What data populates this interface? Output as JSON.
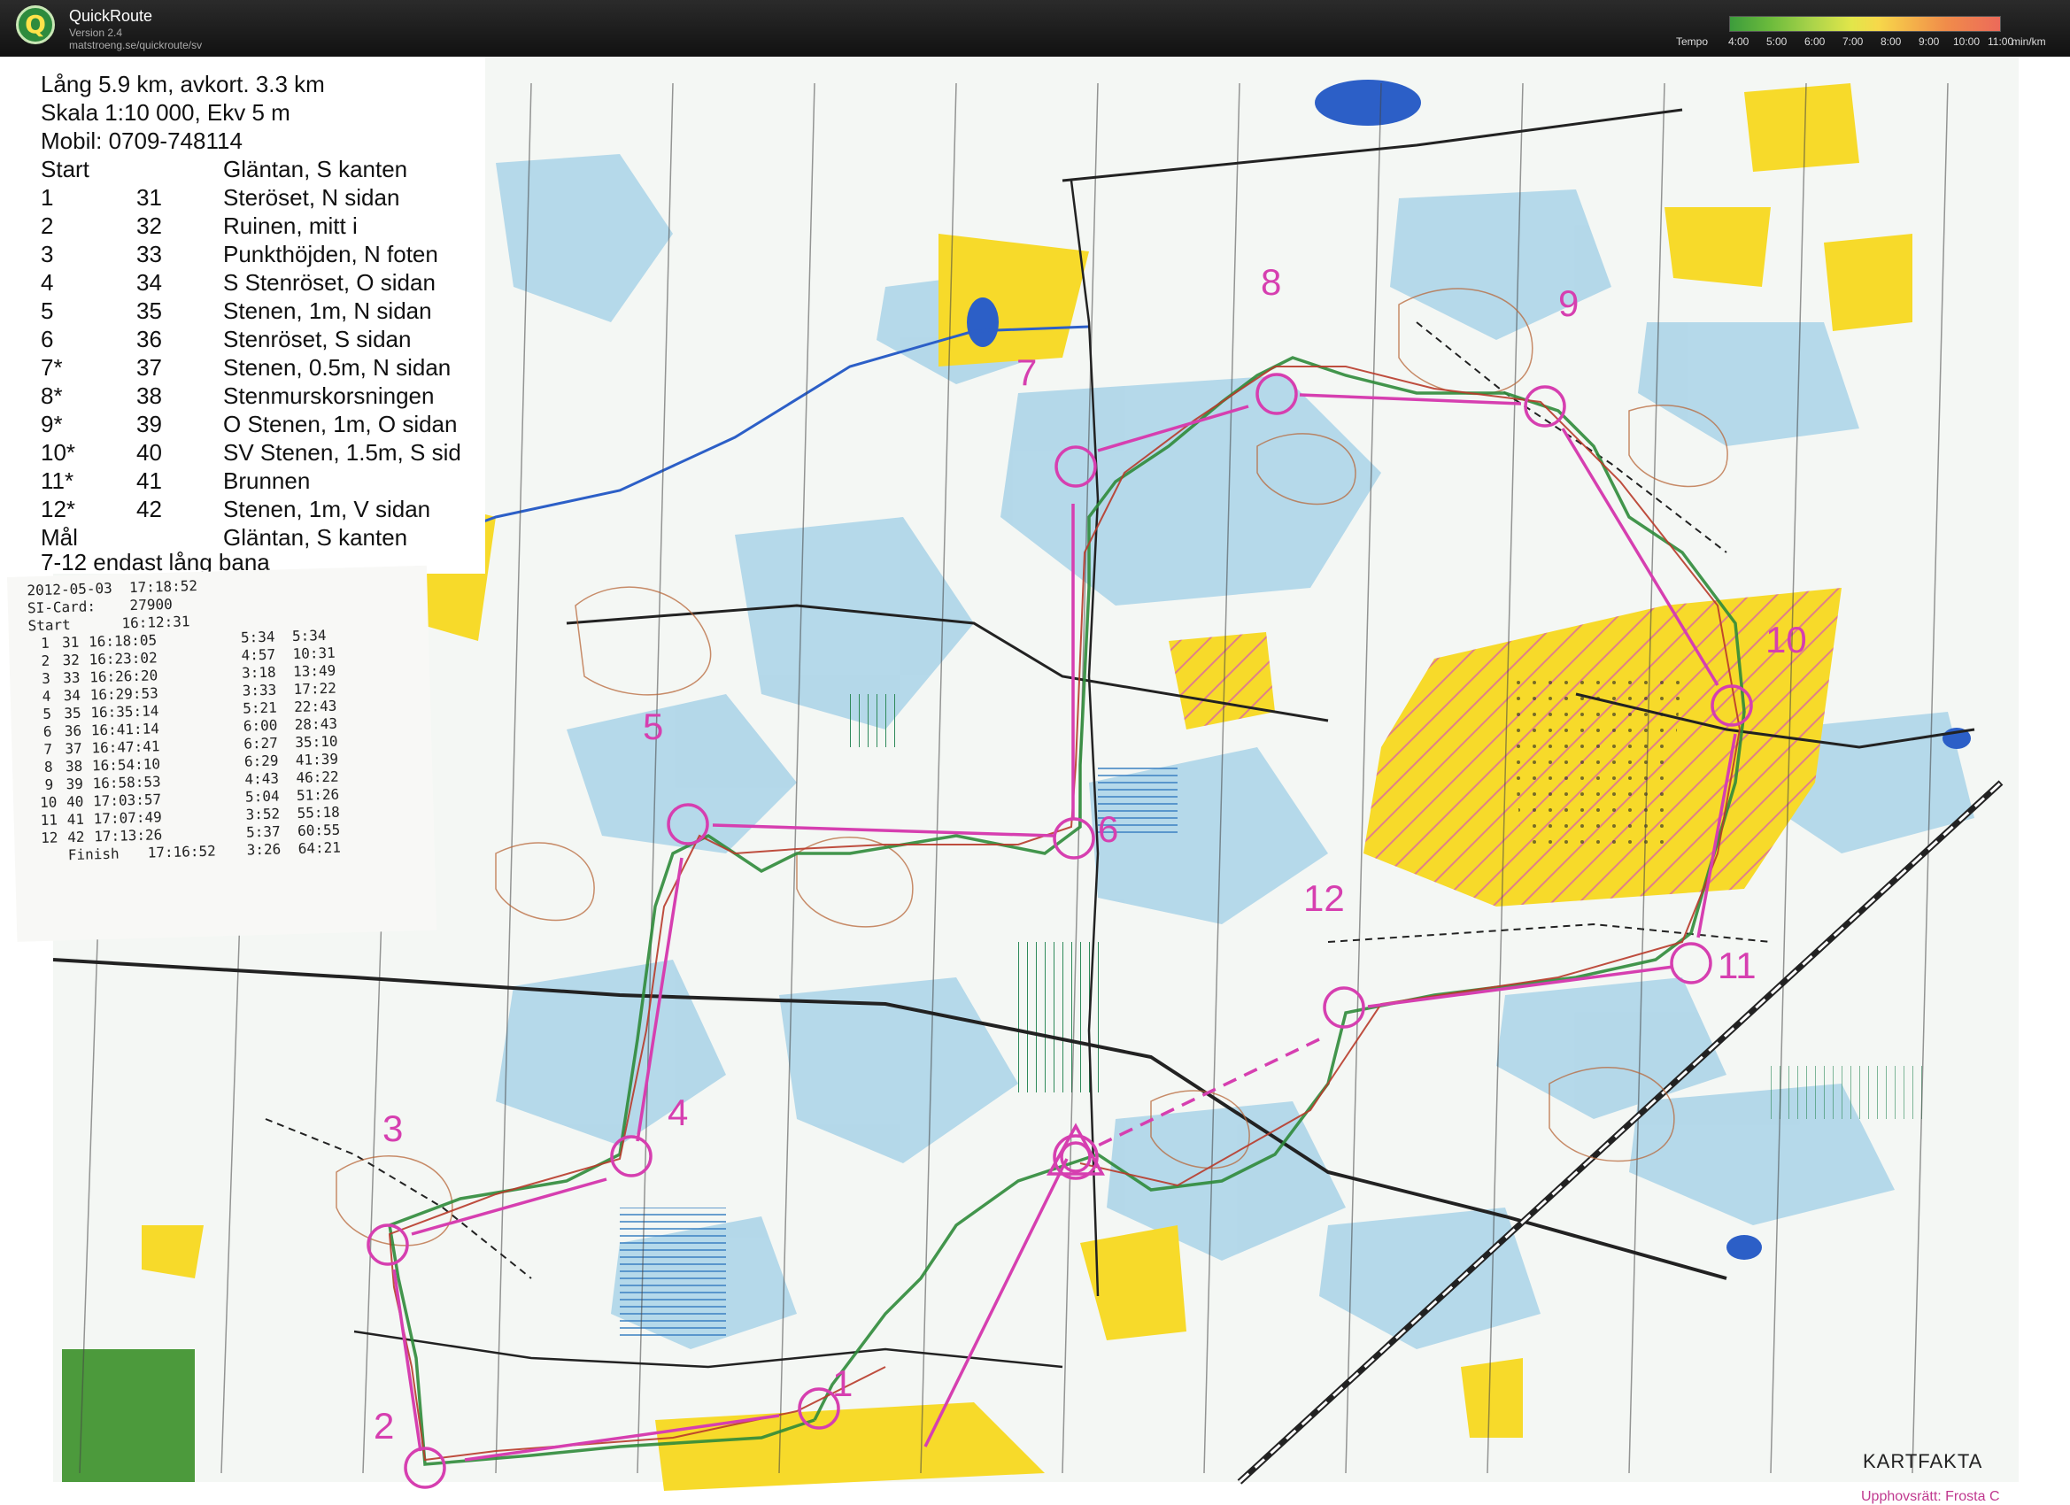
{
  "app": {
    "name": "QuickRoute",
    "version": "Version 2.4",
    "url": "matstroeng.se/quickroute/sv",
    "logo_letter": "Q"
  },
  "tempo_legend": {
    "label": "Tempo",
    "ticks": [
      "4:00",
      "5:00",
      "6:00",
      "7:00",
      "8:00",
      "9:00",
      "10:00",
      "11:00"
    ],
    "unit": "min/km"
  },
  "course_description": {
    "header_lines": [
      "Lång 5.9 km,  avkort. 3.3 km",
      "Skala 1:10 000, Ekv 5 m",
      "Mobil: 0709-748114"
    ],
    "rows": [
      {
        "n": "Start",
        "code": "",
        "desc": "Gläntan, S kanten"
      },
      {
        "n": "1",
        "code": "31",
        "desc": "Steröset, N sidan"
      },
      {
        "n": "2",
        "code": "32",
        "desc": "Ruinen, mitt i"
      },
      {
        "n": "3",
        "code": "33",
        "desc": "Punkthöjden, N foten"
      },
      {
        "n": "4",
        "code": "34",
        "desc": "S Stenröset, O sidan"
      },
      {
        "n": "5",
        "code": "35",
        "desc": "Stenen, 1m, N sidan"
      },
      {
        "n": "6",
        "code": "36",
        "desc": "Stenröset, S sidan"
      },
      {
        "n": "7*",
        "code": "37",
        "desc": "Stenen, 0.5m, N sidan"
      },
      {
        "n": "8*",
        "code": "38",
        "desc": "Stenmurskorsningen"
      },
      {
        "n": "9*",
        "code": "39",
        "desc": "O Stenen, 1m, O sidan"
      },
      {
        "n": "10*",
        "code": "40",
        "desc": "SV Stenen, 1.5m, S sid"
      },
      {
        "n": "11*",
        "code": "41",
        "desc": "Brunnen"
      },
      {
        "n": "12*",
        "code": "42",
        "desc": "Stenen, 1m, V sidan"
      },
      {
        "n": "Mål",
        "code": "",
        "desc": "Gläntan, S kanten"
      }
    ],
    "footer": "7-12 endast lång bana"
  },
  "si_receipt": {
    "datetime": "2012-05-03  17:18:52",
    "card": "SI-Card:    27900",
    "start": "Start      16:12:31",
    "rows": [
      {
        "n": "1",
        "code": "31",
        "time": "16:18:05",
        "split": "5:34",
        "total": "5:34"
      },
      {
        "n": "2",
        "code": "32",
        "time": "16:23:02",
        "split": "4:57",
        "total": "10:31"
      },
      {
        "n": "3",
        "code": "33",
        "time": "16:26:20",
        "split": "3:18",
        "total": "13:49"
      },
      {
        "n": "4",
        "code": "34",
        "time": "16:29:53",
        "split": "3:33",
        "total": "17:22"
      },
      {
        "n": "5",
        "code": "35",
        "time": "16:35:14",
        "split": "5:21",
        "total": "22:43"
      },
      {
        "n": "6",
        "code": "36",
        "time": "16:41:14",
        "split": "6:00",
        "total": "28:43"
      },
      {
        "n": "7",
        "code": "37",
        "time": "16:47:41",
        "split": "6:27",
        "total": "35:10"
      },
      {
        "n": "8",
        "code": "38",
        "time": "16:54:10",
        "split": "6:29",
        "total": "41:39"
      },
      {
        "n": "9",
        "code": "39",
        "time": "16:58:53",
        "split": "4:43",
        "total": "46:22"
      },
      {
        "n": "10",
        "code": "40",
        "time": "17:03:57",
        "split": "5:04",
        "total": "51:26"
      },
      {
        "n": "11",
        "code": "41",
        "time": "17:07:49",
        "split": "3:52",
        "total": "55:18"
      },
      {
        "n": "12",
        "code": "42",
        "time": "17:13:26",
        "split": "5:37",
        "total": "60:55"
      }
    ],
    "finish": {
      "label": "Finish",
      "time": "17:16:52",
      "split": "3:26",
      "total": "64:21"
    }
  },
  "map": {
    "controls": [
      "1",
      "2",
      "3",
      "4",
      "5",
      "6",
      "7",
      "8",
      "9",
      "10",
      "11",
      "12"
    ],
    "kartfakta": "KARTFAKTA",
    "copyright": "Upphovsrätt: Frosta C",
    "colors": {
      "course": "#d63fb0",
      "route_green": "#2f8a3a",
      "route_red": "#b83a2a",
      "open_yellow": "#f7da2a",
      "marsh_blue": "#a9d3e8",
      "vegetation": "#4c9a3c",
      "water": "#2c5fc7"
    }
  }
}
